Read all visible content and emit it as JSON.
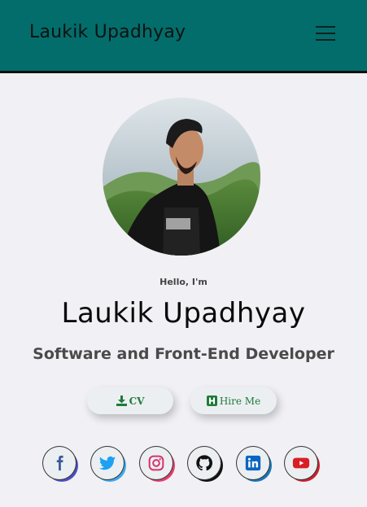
{
  "header": {
    "brand": "Laukik Upadhyay",
    "menu_icon": "hamburger-menu-icon",
    "background": "#036d6b"
  },
  "profile": {
    "avatar_alt": "profile photo",
    "greeting": "Hello, I'm",
    "name": "Laukik Upadhyay",
    "role": "Software and Front-End Developer"
  },
  "buttons": {
    "cv_label": "CV",
    "cv_icon": "download-icon",
    "hire_label": "Hire Me",
    "hire_icon": "hire-h-icon",
    "accent": "#1e7b3a"
  },
  "social": [
    {
      "name": "facebook-icon",
      "color": "#3b5998"
    },
    {
      "name": "twitter-icon",
      "color": "#1da1f2"
    },
    {
      "name": "instagram-icon",
      "color": "#d6336c"
    },
    {
      "name": "github-icon",
      "color": "#111111"
    },
    {
      "name": "linkedin-icon",
      "color": "#0a66c2"
    },
    {
      "name": "youtube-icon",
      "color": "#d81f26"
    }
  ]
}
